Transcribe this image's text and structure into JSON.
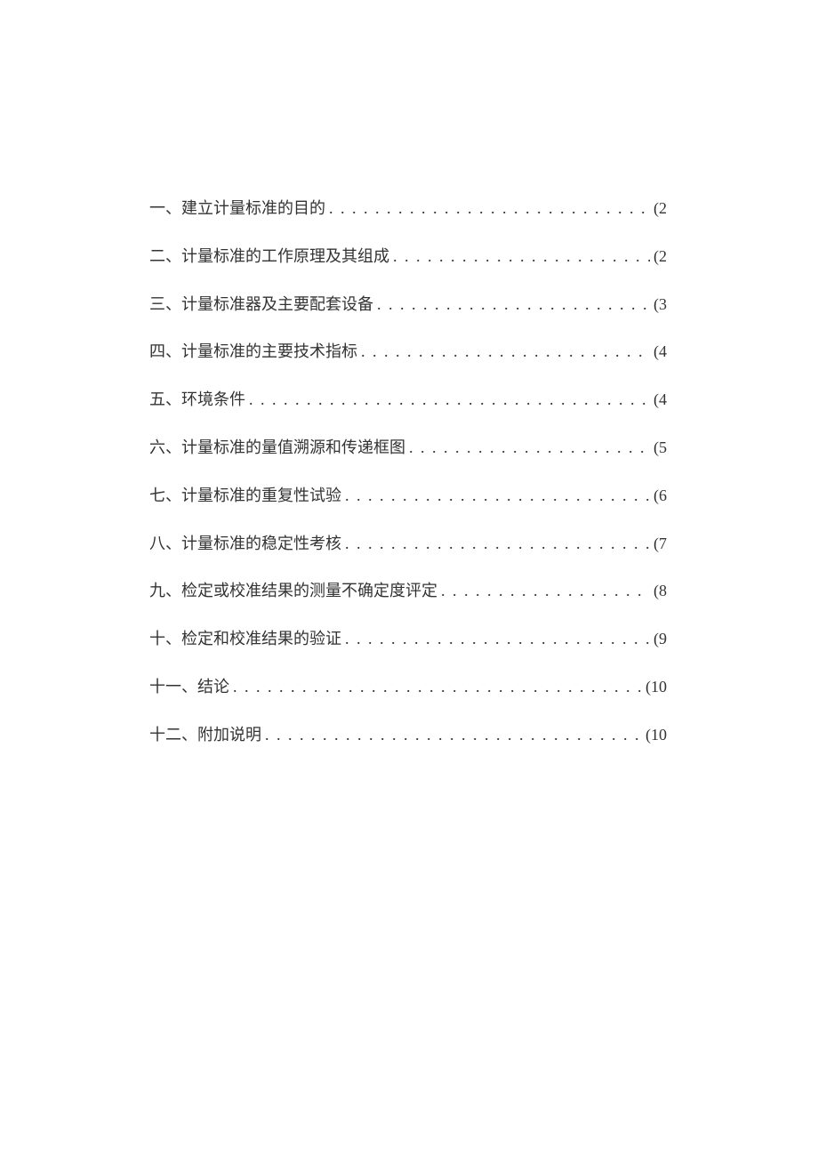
{
  "toc": [
    {
      "title": "一、建立计量标准的目的 ",
      "page": "(2"
    },
    {
      "title": "二、计量标准的工作原理及其组成",
      "page": "(2"
    },
    {
      "title": "三、计量标准器及主要配套设备",
      "page": "(3"
    },
    {
      "title": "四、计量标准的主要技术指标 ",
      "page": "(4"
    },
    {
      "title": "五、环境条件",
      "page": "(4"
    },
    {
      "title": "六、计量标准的量值溯源和传递框图",
      "page": "(5"
    },
    {
      "title": "七、计量标准的重复性试验",
      "page": "(6"
    },
    {
      "title": "八、计量标准的稳定性考核",
      "page": "(7"
    },
    {
      "title": "九、检定或校准结果的测量不确定度评定",
      "page": "(8"
    },
    {
      "title": "十、检定和校准结果的验证 ",
      "page": "(9"
    },
    {
      "title": "十一、结论",
      "page": "(10"
    },
    {
      "title": "十二、附加说明 ",
      "page": "(10"
    }
  ]
}
